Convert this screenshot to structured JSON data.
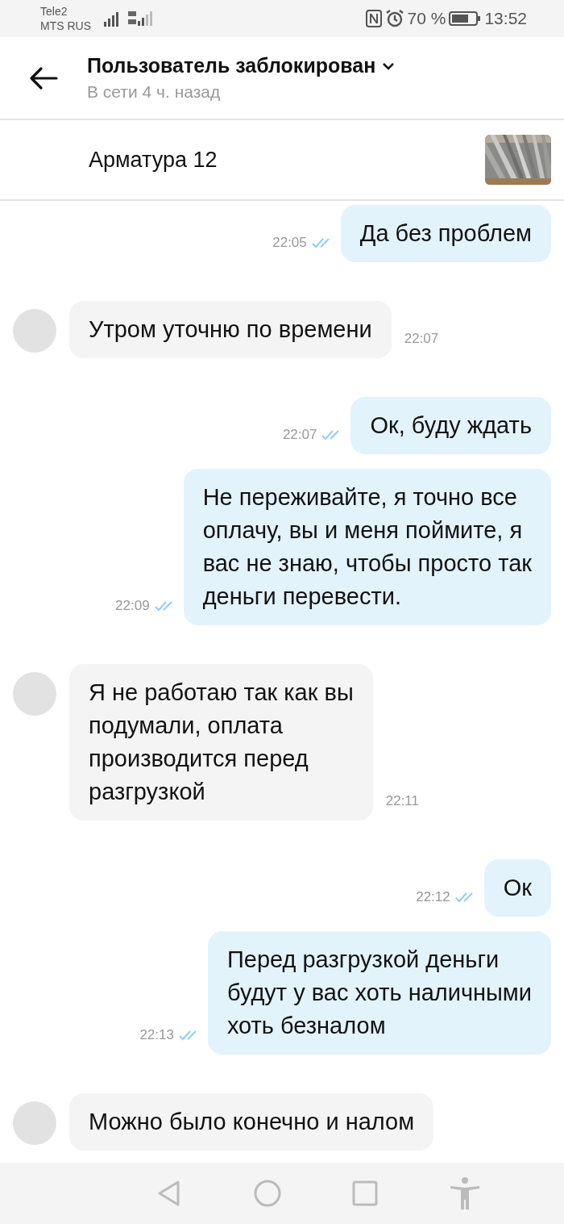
{
  "status_bar": {
    "carriers": [
      "Tele2",
      "MTS RUS"
    ],
    "battery_text": "70 %",
    "time": "13:52"
  },
  "header": {
    "title": "Пользователь заблокирован",
    "subtitle": "В сети 4 ч. назад"
  },
  "listing": {
    "title": "Арматура 12"
  },
  "messages": [
    {
      "kind": "outgoing",
      "lines": [
        "Да без проблем"
      ],
      "time": "22:05",
      "read": true
    },
    {
      "kind": "incoming",
      "lines": [
        "Утром уточню по времени"
      ],
      "time": "22:07"
    },
    {
      "kind": "outgoing",
      "lines": [
        "Ок, буду ждать"
      ],
      "time": "22:07",
      "read": true
    },
    {
      "kind": "outgoing",
      "lines": [
        "Не переживайте, я точно все",
        "оплачу, вы и меня поймите, я",
        "вас не знаю, чтобы просто так",
        "деньги перевести."
      ],
      "time": "22:09",
      "read": true
    },
    {
      "kind": "incoming",
      "lines": [
        "Я не работаю так как вы",
        "подумали, оплата",
        "производится перед",
        "разгрузкой"
      ],
      "time": "22:11"
    },
    {
      "kind": "outgoing",
      "lines": [
        "Ок"
      ],
      "time": "22:12",
      "read": true
    },
    {
      "kind": "outgoing",
      "lines": [
        "Перед разгрузкой деньги",
        "будут у вас хоть наличными",
        "хоть безналом"
      ],
      "time": "22:13",
      "read": true
    },
    {
      "kind": "incoming",
      "lines": [
        "Можно было конечно и налом"
      ]
    }
  ]
}
